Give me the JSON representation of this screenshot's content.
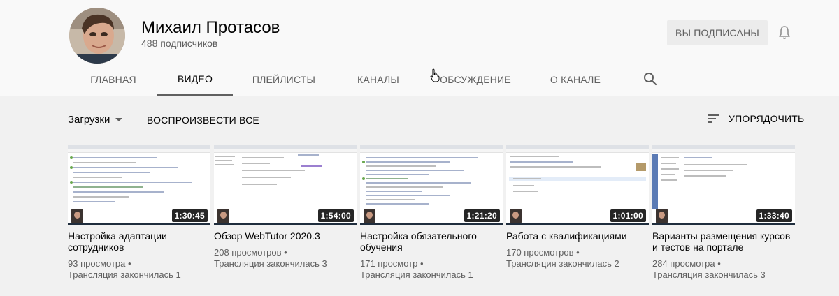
{
  "channel": {
    "name": "Михаил Протасов",
    "subscribers": "488 подписчиков",
    "subscribe_label": "ВЫ ПОДПИСАНЫ",
    "avatar_icon": "user-avatar"
  },
  "tabs": [
    {
      "label": "ГЛАВНАЯ"
    },
    {
      "label": "ВИДЕО"
    },
    {
      "label": "ПЛЕЙЛИСТЫ"
    },
    {
      "label": "КАНАЛЫ"
    },
    {
      "label": "ОБСУЖДЕНИЕ"
    },
    {
      "label": "О КАНАЛЕ"
    }
  ],
  "active_tab": "ВИДЕО",
  "toolbar": {
    "uploads_label": "Загрузки",
    "play_all_label": "ВОСПРОИЗВЕСТИ ВСЕ",
    "sort_label": "УПОРЯДОЧИТЬ"
  },
  "videos": [
    {
      "title": "Настройка адаптации сотрудников",
      "duration": "1:30:45",
      "views": "93 просмотра",
      "status": "Трансляция закончилась 1"
    },
    {
      "title": "Обзор WebTutor 2020.3",
      "duration": "1:54:00",
      "views": "208 просмотров",
      "status": "Трансляция закончилась 3"
    },
    {
      "title": "Настройка обязательного обучения",
      "duration": "1:21:20",
      "views": "171 просмотр",
      "status": "Трансляция закончилась 1"
    },
    {
      "title": "Работа с квалификациями",
      "duration": "1:01:00",
      "views": "170 просмотров",
      "status": "Трансляция закончилась 2"
    },
    {
      "title": "Варианты размещения курсов и тестов на портале",
      "duration": "1:33:40",
      "views": "284 просмотра",
      "status": "Трансляция закончилась 3"
    }
  ],
  "meta_separator": "•",
  "colors": {
    "header_bg": "#f9f9f9",
    "page_bg": "#f1f1f1",
    "text_primary": "#030303",
    "text_secondary": "#606060",
    "button_bg": "#ececec"
  }
}
